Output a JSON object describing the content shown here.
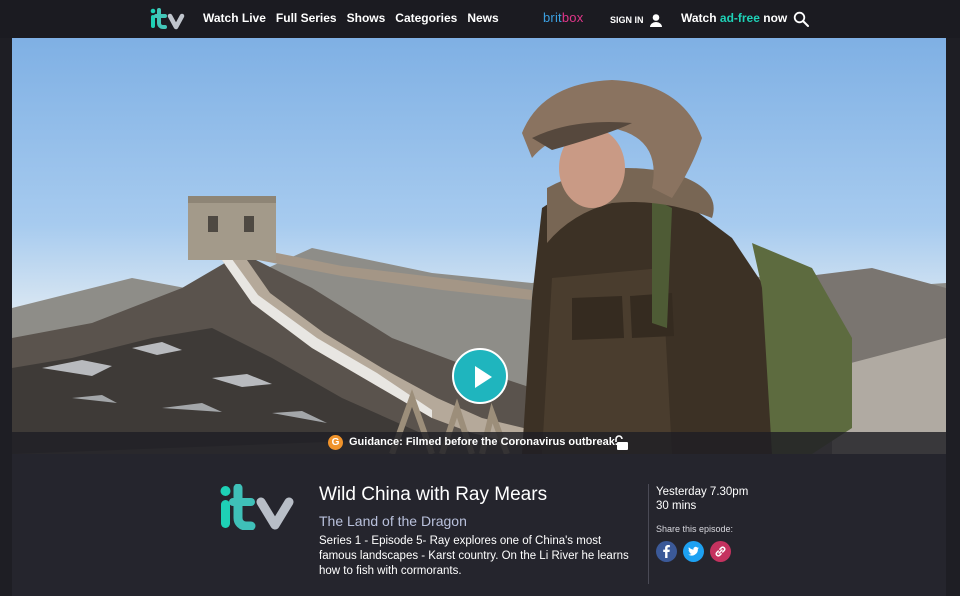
{
  "nav": {
    "logo_alt": "itv",
    "links": [
      "Watch Live",
      "Full Series",
      "Shows",
      "Categories",
      "News"
    ],
    "britbox_a": "brit",
    "britbox_b": "box",
    "signin": "SIGN IN",
    "watch_prefix": "Watch ",
    "watch_highlight": "ad-free",
    "watch_suffix": " now"
  },
  "hero": {
    "guidance_badge": "G",
    "guidance_text": "Guidance: Filmed before the Coronavirus outbreak."
  },
  "episode": {
    "channel_logo": "itv",
    "title": "Wild China with Ray Mears",
    "subtitle": "The Land of the Dragon",
    "description": "Series 1 - Episode 5- Ray explores one of China's most famous landscapes - Karst country. On the Li River he learns how to fish with cormorants.",
    "air_time": "Yesterday 7.30pm",
    "duration": "30 mins",
    "share_label": "Share this episode:"
  },
  "colors": {
    "accent_teal": "#1ed1b6",
    "play_button": "#1fb5be",
    "britbox_blue": "#3b9fe0",
    "britbox_pink": "#e0368a",
    "guidance_orange": "#f0932b"
  },
  "icons": [
    "itv-logo",
    "user-icon",
    "search-icon",
    "play-icon",
    "guidance-icon",
    "unlock-icon",
    "facebook-icon",
    "twitter-icon",
    "link-icon"
  ]
}
